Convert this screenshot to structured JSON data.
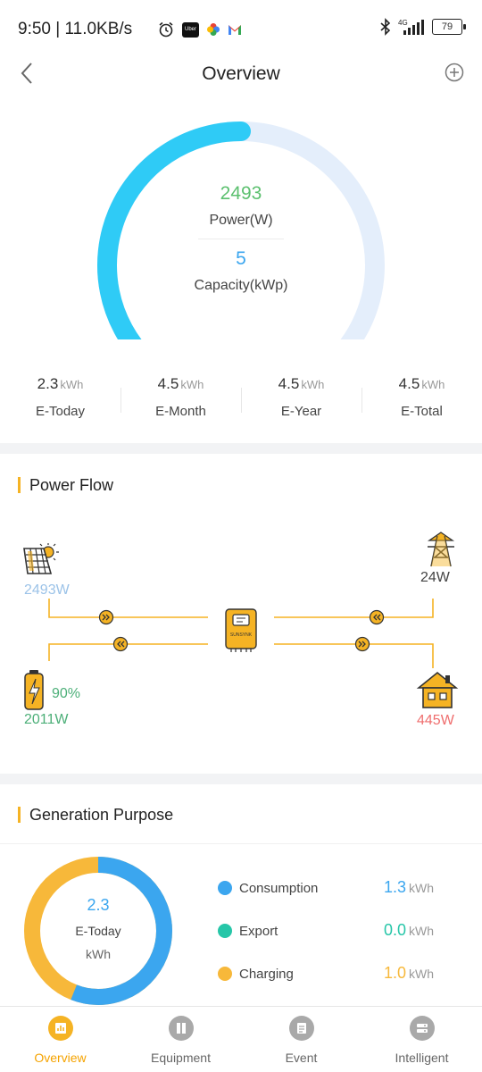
{
  "status_bar": {
    "time_speed": "9:50 | 11.0KB/s",
    "uber_label": "Uber",
    "network": "4G",
    "battery": "79"
  },
  "header": {
    "title": "Overview"
  },
  "gauge": {
    "power_value": "2493",
    "power_label": "Power(W)",
    "capacity_value": "5",
    "capacity_label": "Capacity(kWp)",
    "fill_fraction": 0.5
  },
  "stats": [
    {
      "value": "2.3",
      "unit": "kWh",
      "label": "E-Today"
    },
    {
      "value": "4.5",
      "unit": "kWh",
      "label": "E-Month"
    },
    {
      "value": "4.5",
      "unit": "kWh",
      "label": "E-Year"
    },
    {
      "value": "4.5",
      "unit": "kWh",
      "label": "E-Total"
    }
  ],
  "power_flow": {
    "title": "Power Flow",
    "solar": "2493W",
    "grid": "24W",
    "battery_percent": "90%",
    "battery_power": "2011W",
    "load": "445W",
    "inverter_brand": "SUNSYNK"
  },
  "generation": {
    "title": "Generation Purpose",
    "value": "2.3",
    "label": "E-Today",
    "unit": "kWh",
    "consumption_fraction": 0.56,
    "items": [
      {
        "name": "Consumption",
        "value": "1.3",
        "unit": "kWh",
        "color": "#3ba6ef"
      },
      {
        "name": "Export",
        "value": "0.0",
        "unit": "kWh",
        "color": "#26c6a8"
      },
      {
        "name": "Charging",
        "value": "1.0",
        "unit": "kWh",
        "color": "#f7b83a"
      }
    ]
  },
  "nav": [
    {
      "label": "Overview",
      "icon": "overview-icon",
      "active": true
    },
    {
      "label": "Equipment",
      "icon": "equipment-icon",
      "active": false
    },
    {
      "label": "Event",
      "icon": "event-icon",
      "active": false
    },
    {
      "label": "Intelligent",
      "icon": "intelligent-icon",
      "active": false
    }
  ],
  "colors": {
    "accent": "#f5b324",
    "power_green": "#5cc06f",
    "capacity_blue": "#3ba6ef",
    "gauge_fill": "#2fcbf6",
    "gauge_track": "#e4eefb",
    "solar_text": "#9cc3e8",
    "battery_text": "#4caf78",
    "load_text": "#ef6e6e",
    "flow_line": "#f5b324"
  }
}
